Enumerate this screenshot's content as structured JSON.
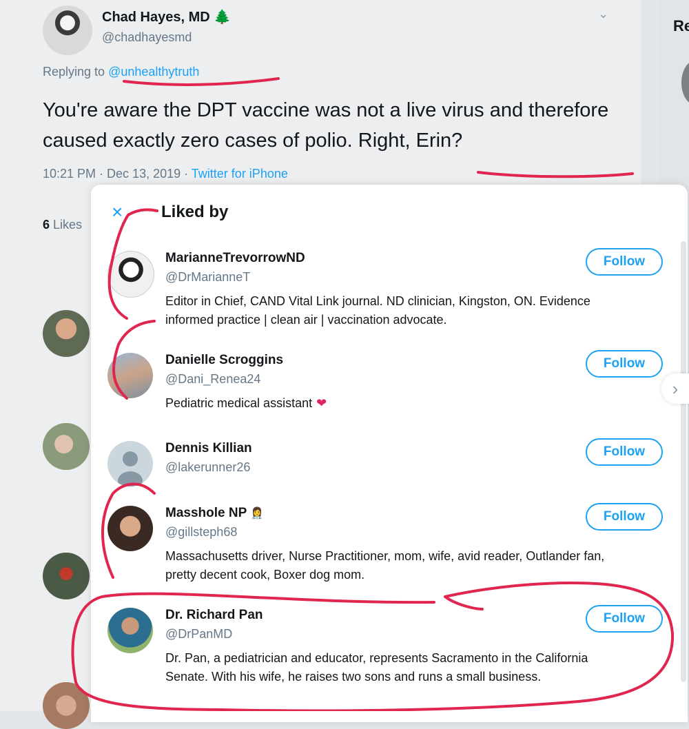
{
  "tweet": {
    "author_name": "Chad Hayes, MD",
    "author_badge": "🌲",
    "author_handle": "@chadhayesmd",
    "replying_prefix": "Replying to",
    "replying_to": "@unhealthytruth",
    "text": "You're aware the DPT vaccine was not a live virus and therefore caused exactly zero cases of polio. Right, Erin?",
    "time": "10:21 PM · Dec 13, 2019 · ",
    "source": "Twitter for iPhone",
    "likes_count": "6",
    "likes_label": " Likes"
  },
  "right_panel": {
    "heading": "Re"
  },
  "modal": {
    "close_icon": "×",
    "title": "Liked by",
    "users": [
      {
        "name": "MarianneTrevorrowND",
        "handle": "@DrMarianneT",
        "bio": "Editor in Chief, CAND Vital Link journal. ND clinician, Kingston, ON. Evidence informed practice | clean air | vaccination advocate.",
        "button": "Follow"
      },
      {
        "name": "Danielle Scroggins",
        "handle": "@Dani_Renea24",
        "bio": "Pediatric medical assistant",
        "bio_emoji": "❤",
        "button": "Follow"
      },
      {
        "name": "Dennis Killian",
        "handle": "@lakerunner26",
        "bio": "",
        "button": "Follow"
      },
      {
        "name": "Masshole NP",
        "name_emoji": "👩‍⚕️",
        "handle": "@gillsteph68",
        "bio": "Massachusetts driver, Nurse Practitioner, mom, wife, avid reader, Outlander fan, pretty decent cook, Boxer dog mom.",
        "button": "Follow"
      },
      {
        "name": "Dr. Richard Pan",
        "handle": "@DrPanMD",
        "bio": "Dr. Pan, a pediatrician and educator, represents Sacramento in the California Senate. With his wife, he raises two sons and runs a small business.",
        "button": "Follow"
      }
    ]
  },
  "colors": {
    "accent": "#1da1f2",
    "annotation": "#e0254f",
    "heart": "#e0245e"
  }
}
